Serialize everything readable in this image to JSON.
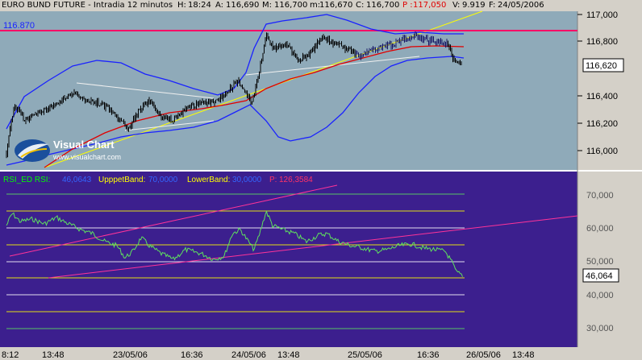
{
  "header": {
    "instrument": "EURO BUND FUTURE - Intradia 12 minutos",
    "h_label": "H:",
    "h_value": "18:24",
    "a_label": "A:",
    "a_value": "116,690",
    "m_label": "M:",
    "m_value": "116,700",
    "mn_label": "m:",
    "mn_value": "116,670",
    "c_label": "C:",
    "c_value": "116,700",
    "p_label": "P :",
    "p_value": "117,050",
    "v_label": "V:",
    "v_value": "9.919",
    "f_label": "F:",
    "f_value": "24/05/2006"
  },
  "price_panel": {
    "ref_line_label": "116.870",
    "axis_ticks": [
      "117,000",
      "116,800",
      "116,400",
      "116,200",
      "116,000"
    ],
    "last_price": "116,620"
  },
  "logo": {
    "name": "Visual Chart",
    "url": "www.visualchart.com"
  },
  "rsi_panel": {
    "legend_name": "RSI_ED  RSI:",
    "legend_rsi_val": "46,0643",
    "upper_label": "UpppetBand:",
    "upper_val": "70,0000",
    "lower_label": "LowerBand:",
    "lower_val": "30,0000",
    "p_label": "P:",
    "p_val": "126,3584",
    "axis_ticks": [
      "70,000",
      "60,000",
      "50,000",
      "40,000",
      "30,000"
    ],
    "last_value": "46,064"
  },
  "time_axis": {
    "labels": [
      "8:12",
      "13:48",
      "23/05/06",
      "16:36",
      "24/05/06",
      "13:48",
      "25/05/06",
      "16:36",
      "26/05/06",
      "13:48"
    ]
  },
  "colors": {
    "panel_bg": "#8faab9",
    "rsi_bg": "#3c1f8e",
    "axis_bg": "#d4d0c8",
    "ref_line": "#ff0066",
    "bollinger": "#1a22ff",
    "ma_red": "#e00000",
    "trend_yellow": "#ffff00",
    "rsi_line": "#5ee05e"
  }
}
